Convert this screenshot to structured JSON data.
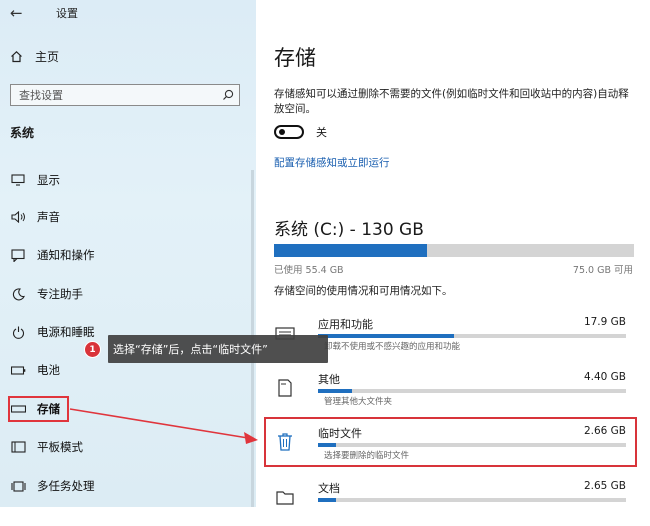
{
  "window": {
    "title": "设置",
    "back_icon": "back-arrow-icon"
  },
  "sidebar": {
    "home_label": "主页",
    "search_placeholder": "查找设置",
    "section_label": "系统",
    "items": [
      {
        "label": "显示",
        "icon": "display-icon"
      },
      {
        "label": "声音",
        "icon": "sound-icon"
      },
      {
        "label": "通知和操作",
        "icon": "notifications-icon"
      },
      {
        "label": "专注助手",
        "icon": "focus-assist-icon"
      },
      {
        "label": "电源和睡眠",
        "icon": "power-icon"
      },
      {
        "label": "电池",
        "icon": "battery-icon"
      },
      {
        "label": "存储",
        "icon": "storage-icon",
        "selected": true
      },
      {
        "label": "平板模式",
        "icon": "tablet-icon"
      },
      {
        "label": "多任务处理",
        "icon": "multitasking-icon"
      }
    ]
  },
  "main": {
    "title": "存储",
    "storage_sense_desc": "存储感知可以通过删除不需要的文件(例如临时文件和回收站中的内容)自动释放空间。",
    "toggle_label": "关",
    "toggle_on": false,
    "config_link": "配置存储感知或立即运行",
    "drive": {
      "title": "系统 (C:) - 130 GB",
      "used_label": "已使用 55.4 GB",
      "free_label": "75.0 GB 可用",
      "used_fraction": 0.426
    },
    "usage_desc": "存储空间的使用情况和可用情况如下。",
    "categories": [
      {
        "name": "应用和功能",
        "size": "17.9 GB",
        "sub": "卸载不使用或不感兴趣的应用和功能",
        "fill": 0.44,
        "icon": "apps-icon"
      },
      {
        "name": "其他",
        "size": "4.40 GB",
        "sub": "管理其他大文件夹",
        "fill": 0.11,
        "icon": "other-files-icon"
      },
      {
        "name": "临时文件",
        "size": "2.66 GB",
        "sub": "选择要删除的临时文件",
        "fill": 0.06,
        "icon": "trash-icon"
      },
      {
        "name": "文档",
        "size": "2.65 GB",
        "sub": "",
        "fill": 0.06,
        "icon": "documents-icon"
      }
    ]
  },
  "annotation": {
    "step_number": "1",
    "tooltip_text": "选择“存储”后，点击“临时文件”",
    "highlight_color": "#e0353c"
  },
  "colors": {
    "accent": "#1f6fbf",
    "link": "#1a5fb0",
    "track": "#d4d4d4"
  }
}
